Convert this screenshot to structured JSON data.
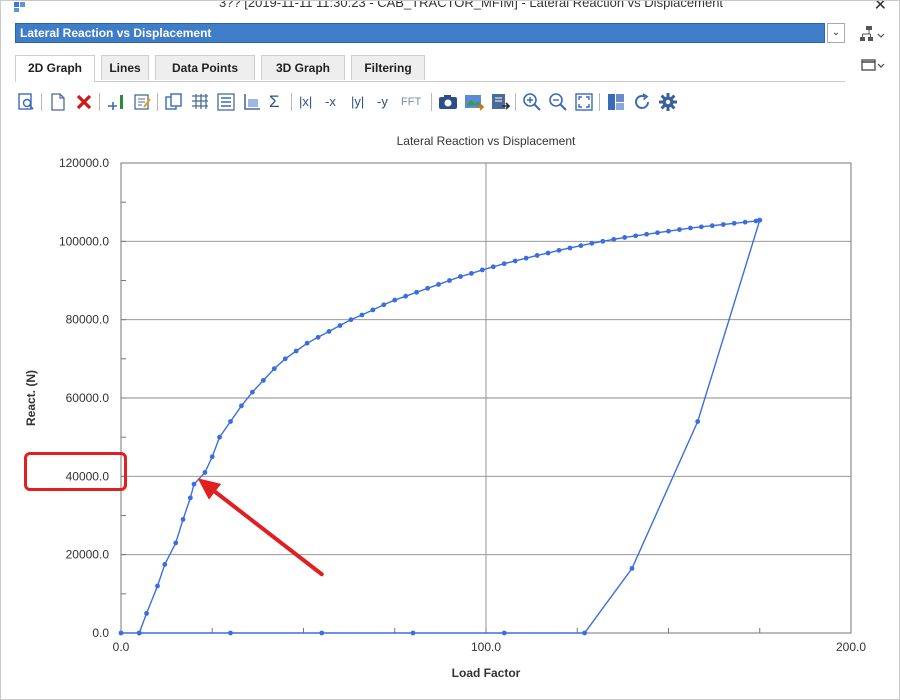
{
  "window": {
    "title": "3?? [2019-11-11 11:30:23 - CAB_TRACTOR_MFIM] - Lateral Reaction vs Displacement"
  },
  "graph_selector": {
    "selected": "Lateral Reaction vs Displacement"
  },
  "tabs": [
    {
      "label": "2D Graph",
      "active": true
    },
    {
      "label": "Lines",
      "active": false
    },
    {
      "label": "Data Points",
      "active": false
    },
    {
      "label": "3D Graph",
      "active": false
    },
    {
      "label": "Filtering",
      "active": false
    }
  ],
  "toolbar": {
    "abs_x": "|x|",
    "neg_x": "-x",
    "abs_y": "|y|",
    "neg_y": "-y",
    "fft": "FFT",
    "sigma": "Σ"
  },
  "colors": {
    "series": "#3a6ee0",
    "selector_bg": "#3f7dc8",
    "annotation": "#e02020"
  },
  "chart_data": {
    "type": "line",
    "title": "Lateral Reaction vs Displacement",
    "xlabel": "Load Factor",
    "ylabel": "React. (N)",
    "xlim": [
      0,
      200
    ],
    "ylim": [
      0,
      120000
    ],
    "x_ticks": [
      0,
      100,
      200
    ],
    "x_tick_labels": [
      "0.0",
      "100.0",
      "200.0"
    ],
    "y_ticks": [
      0,
      20000,
      40000,
      60000,
      80000,
      100000,
      120000
    ],
    "y_tick_labels": [
      "0.0",
      "20000.0",
      "40000.0",
      "60000.0",
      "80000.0",
      "100000.0",
      "120000.0"
    ],
    "grid": true,
    "series": [
      {
        "x": [
          0,
          5,
          7,
          10,
          12,
          15,
          17,
          19,
          20,
          23,
          25,
          27,
          30,
          33,
          36,
          39,
          42,
          45,
          48,
          51,
          54,
          57,
          60,
          63,
          66,
          69,
          72,
          75,
          78,
          81,
          84,
          87,
          90,
          93,
          96,
          99,
          102,
          105,
          108,
          111,
          114,
          117,
          120,
          123,
          126,
          129,
          132,
          135,
          138,
          141,
          144,
          147,
          150,
          153,
          156,
          159,
          162,
          165,
          168,
          171,
          174,
          175
        ],
        "y": [
          0,
          0,
          5000,
          12000,
          17500,
          23000,
          29000,
          34500,
          38000,
          41000,
          45000,
          50000,
          54000,
          58000,
          61500,
          64500,
          67500,
          70000,
          72000,
          74000,
          75500,
          77000,
          78500,
          80000,
          81200,
          82500,
          83800,
          85000,
          86000,
          87000,
          88000,
          89000,
          90000,
          91000,
          91800,
          92700,
          93500,
          94300,
          95000,
          95700,
          96400,
          97000,
          97700,
          98300,
          98900,
          99500,
          100000,
          100500,
          101000,
          101400,
          101800,
          102200,
          102600,
          103000,
          103400,
          103700,
          104000,
          104300,
          104600,
          104900,
          105200,
          105400
        ]
      },
      {
        "x": [
          175,
          158,
          140,
          127,
          105,
          80,
          55,
          30,
          5
        ],
        "y": [
          105400,
          54000,
          16500,
          0,
          0,
          0,
          0,
          0,
          0
        ]
      }
    ],
    "markers_first_series": [
      0,
      5,
      7,
      10,
      12,
      15,
      17,
      19,
      20,
      23,
      25,
      27,
      30,
      33,
      36,
      39,
      42,
      45,
      48,
      51,
      54,
      57,
      60,
      63,
      66,
      69,
      72,
      75,
      78,
      81,
      84,
      87,
      90,
      93,
      96,
      99,
      102,
      105,
      108,
      111,
      114,
      117,
      120,
      123,
      126,
      129,
      132,
      135,
      138,
      141,
      144,
      147,
      150,
      153,
      156,
      159,
      162,
      165,
      168,
      171,
      174,
      175
    ],
    "annotation": {
      "type": "arrow",
      "target": [
        21,
        39500
      ],
      "from": [
        55,
        15000
      ],
      "highlighted_tick": "40000.0"
    }
  }
}
